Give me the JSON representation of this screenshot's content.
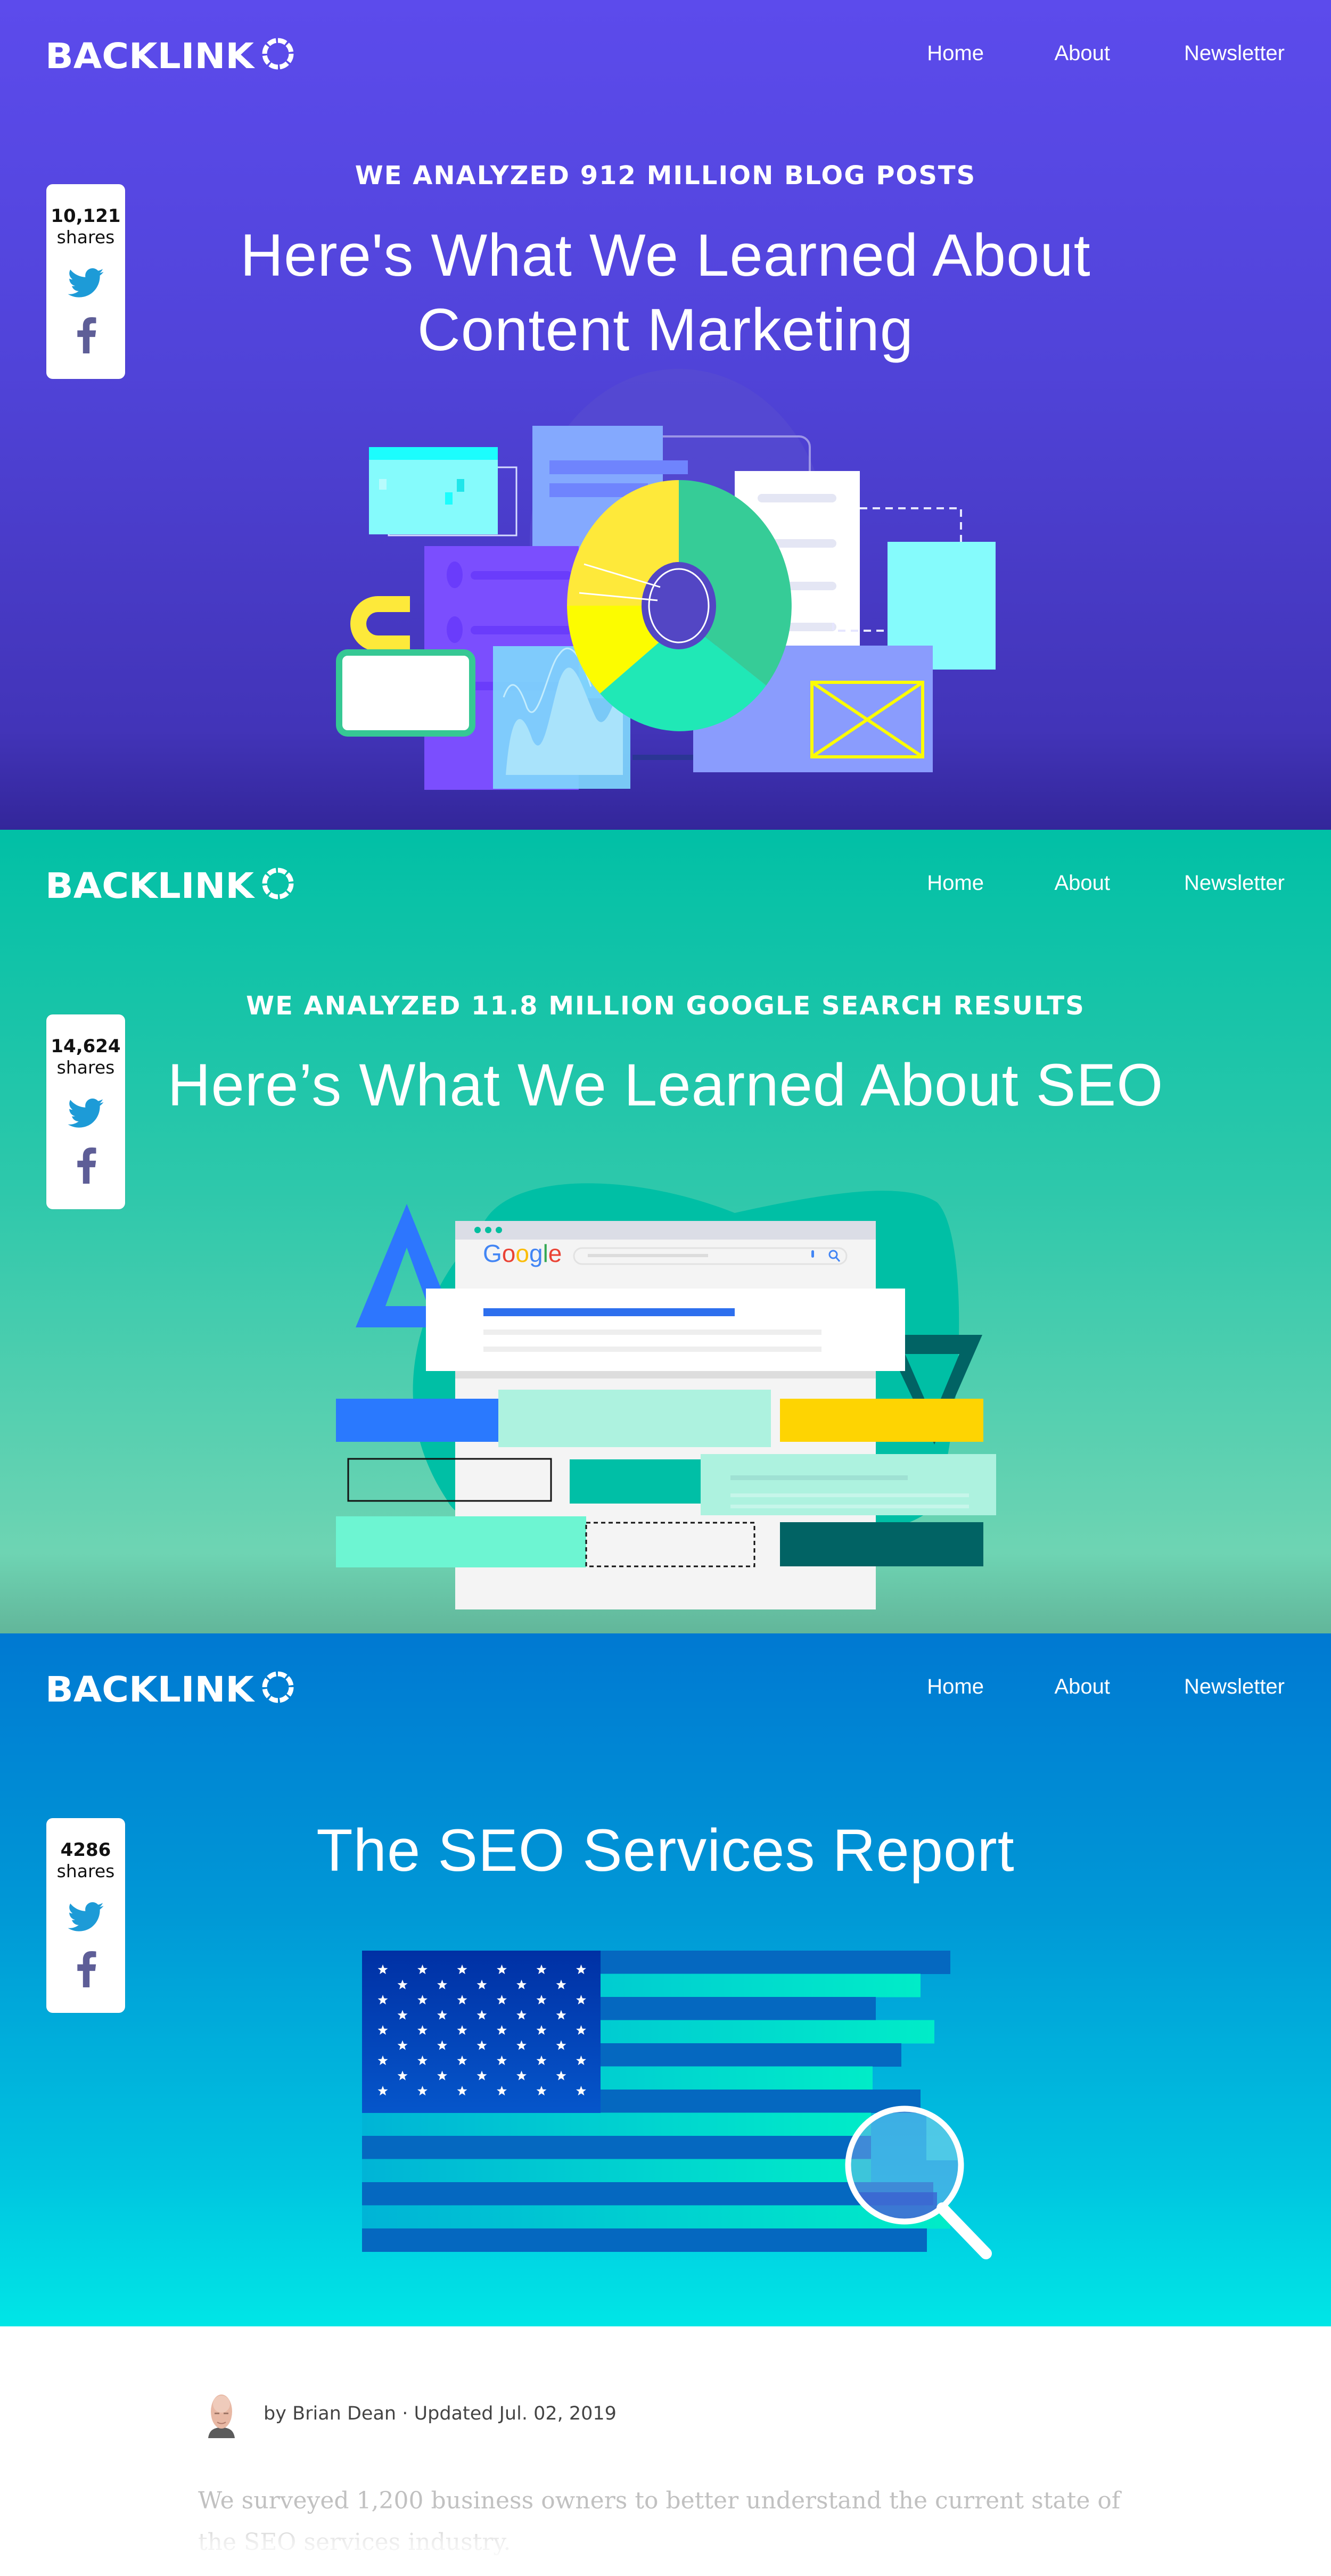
{
  "brand": {
    "logo_text": "BACKLINKO"
  },
  "nav": {
    "items": [
      {
        "label": "Home"
      },
      {
        "label": "About"
      },
      {
        "label": "Newsletter"
      }
    ]
  },
  "colors": {
    "hero1": "#5c4bec",
    "hero2": "#01c0a6",
    "hero3": "#0079d2",
    "twitter": "#1d9bd7",
    "facebook": "#5e5e97"
  },
  "posts": [
    {
      "eyebrow": "WE ANALYZED 912 MILLION BLOG POSTS",
      "title_line1": "Here's What We Learned About",
      "title_line2": "Content Marketing",
      "shares": {
        "count": "10,121",
        "label": "shares"
      },
      "illustration": "content-marketing-donut-illustration"
    },
    {
      "eyebrow": "WE ANALYZED 11.8 MILLION GOOGLE SEARCH RESULTS",
      "title_line1": "Here’s What We Learned About SEO",
      "shares": {
        "count": "14,624",
        "label": "shares"
      },
      "illustration": "google-search-results-illustration",
      "google_logo": "Google"
    },
    {
      "title_line1": "The SEO Services Report",
      "shares": {
        "count": "4286",
        "label": "shares"
      },
      "illustration": "us-flag-magnifier-illustration"
    }
  ],
  "article": {
    "author_prefix": "by",
    "author": "Brian Dean",
    "separator": "·",
    "updated": "Updated Jul. 02, 2019",
    "intro": "We surveyed 1,200 business owners to better understand the current state of the SEO services industry."
  }
}
